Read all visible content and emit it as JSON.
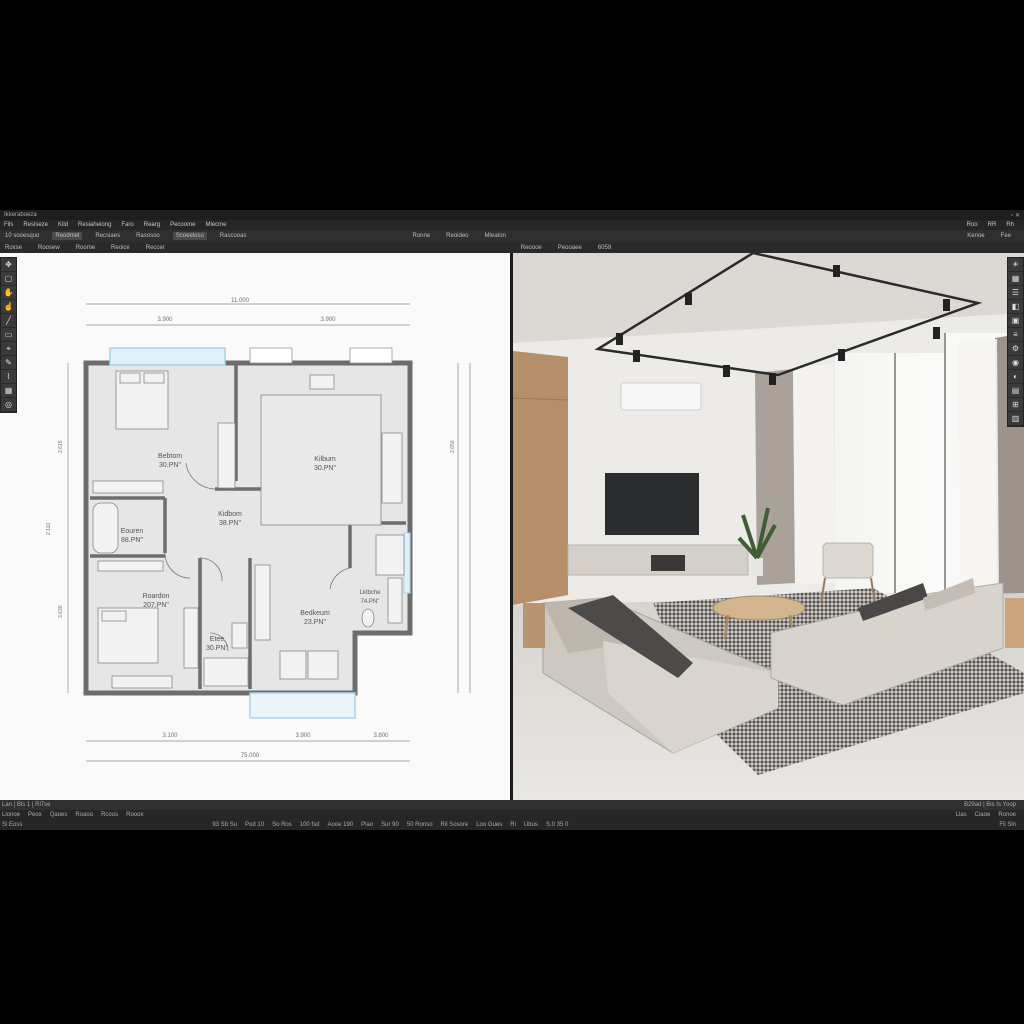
{
  "titlebar": {
    "app_title": "Ikkeraboeza",
    "window_controls": "▫ ✕"
  },
  "menubar": {
    "items": [
      "Fils",
      "Resiseze",
      "Kild",
      "Resiaheiong",
      "Faro",
      "Rearg",
      "Pecoome",
      "Mlecme"
    ],
    "right_items": [
      "Roo",
      "RR",
      "Rh"
    ]
  },
  "toolbar": {
    "items": [
      "10 sooesquo",
      "Reodmel",
      "Recsiaes",
      "Rasosoo",
      "Scoeeloso",
      "Rascuoas"
    ],
    "center_items": [
      "Ronne",
      "Reoideo",
      "Mleaton"
    ],
    "right_items": [
      "Kenoe",
      "Fee"
    ]
  },
  "tabrow": {
    "left_items": [
      "Roxse",
      "Roosew",
      "Roome",
      "Reoice",
      "Reccer"
    ],
    "right_items": [
      "Reoooe",
      "Peooaee",
      "6059"
    ]
  },
  "colors": {
    "wall": "#6d6d6d",
    "floor": "#e4e4e4",
    "window": "#a9d3ea",
    "dim": "#707070"
  },
  "floorplan": {
    "dims": {
      "top_total": "11.000",
      "top_left": "3.900",
      "top_right": "3.900",
      "bottom_1": "3.100",
      "bottom_2": "3.900",
      "bottom_3": "3.800",
      "bottom_total": "75.000",
      "side_1": "2.615",
      "side_2": "2.110",
      "side_3": "3.630",
      "side_4": "2.650"
    },
    "rooms": [
      {
        "name": "Bebtom",
        "area": "30.PN\""
      },
      {
        "name": "Kilbum",
        "area": "30.PN\""
      },
      {
        "name": "Kidbom",
        "area": "38.PN\""
      },
      {
        "name": "Eouren",
        "area": "88.PN\""
      },
      {
        "name": "Roardon",
        "area": "207.PN\""
      },
      {
        "name": "Etee",
        "area": "30.PN\""
      },
      {
        "name": "Bedkeum",
        "area": "23.PN\""
      },
      {
        "name": "Lktbche",
        "area": "74.PN\""
      }
    ]
  },
  "left_tools": [
    "move-icon",
    "select-icon",
    "hand-icon",
    "hand-icon",
    "line-icon",
    "ruler-icon",
    "snap-icon",
    "pencil-icon",
    "brush-icon",
    "grid-icon",
    "target-icon"
  ],
  "right_tools": [
    "lamp-icon",
    "grid-icon",
    "list-icon",
    "layers-icon",
    "image-icon",
    "list-icon",
    "settings-icon",
    "camera-icon",
    "view-icon",
    "panel-icon",
    "grid-icon",
    "panel-icon"
  ],
  "status": {
    "row1_left": [
      "Lan | Bls 1 | Rl7se"
    ],
    "row1_right": [
      "B29ad | Bis Is Yoop"
    ],
    "row2": [
      "Llonoe",
      "Peox",
      "Qaoes",
      "Roaoo",
      "Rcoos",
      "Rooox"
    ],
    "row2_right": [
      "Llas",
      "Ciaoe",
      "Ronoe"
    ],
    "row3_left": [
      "Sl Eoss"
    ],
    "row3": [
      "93 Sb Su",
      "Pod 10",
      "So Ros",
      "100 fsd",
      "Aooe 190",
      "Plao",
      "Sur 90",
      "50 Ronso",
      "Ril Sosore",
      "Loo Gues",
      "Ri",
      "Ubus",
      "S.0 35 0"
    ],
    "row3_right": [
      "Fli Sln"
    ]
  }
}
